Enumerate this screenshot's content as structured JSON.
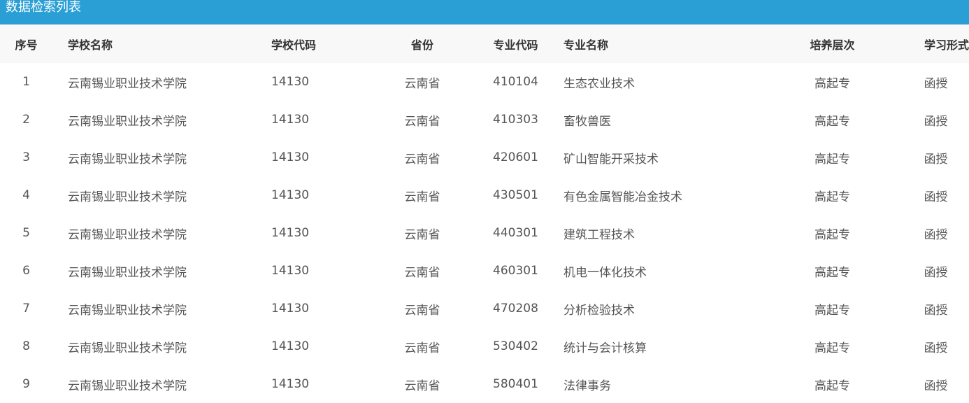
{
  "header": {
    "title": "数据检索列表"
  },
  "table": {
    "columns": [
      "序号",
      "学校名称",
      "学校代码",
      "省份",
      "专业代码",
      "专业名称",
      "培养层次",
      "学习形式"
    ],
    "rows": [
      [
        "1",
        "云南锡业职业技术学院",
        "14130",
        "云南省",
        "410104",
        "生态农业技术",
        "高起专",
        "函授"
      ],
      [
        "2",
        "云南锡业职业技术学院",
        "14130",
        "云南省",
        "410303",
        "畜牧兽医",
        "高起专",
        "函授"
      ],
      [
        "3",
        "云南锡业职业技术学院",
        "14130",
        "云南省",
        "420601",
        "矿山智能开采技术",
        "高起专",
        "函授"
      ],
      [
        "4",
        "云南锡业职业技术学院",
        "14130",
        "云南省",
        "430501",
        "有色金属智能冶金技术",
        "高起专",
        "函授"
      ],
      [
        "5",
        "云南锡业职业技术学院",
        "14130",
        "云南省",
        "440301",
        "建筑工程技术",
        "高起专",
        "函授"
      ],
      [
        "6",
        "云南锡业职业技术学院",
        "14130",
        "云南省",
        "460301",
        "机电一体化技术",
        "高起专",
        "函授"
      ],
      [
        "7",
        "云南锡业职业技术学院",
        "14130",
        "云南省",
        "470208",
        "分析检验技术",
        "高起专",
        "函授"
      ],
      [
        "8",
        "云南锡业职业技术学院",
        "14130",
        "云南省",
        "530402",
        "统计与会计核算",
        "高起专",
        "函授"
      ],
      [
        "9",
        "云南锡业职业技术学院",
        "14130",
        "云南省",
        "580401",
        "法律事务",
        "高起专",
        "函授"
      ]
    ]
  }
}
